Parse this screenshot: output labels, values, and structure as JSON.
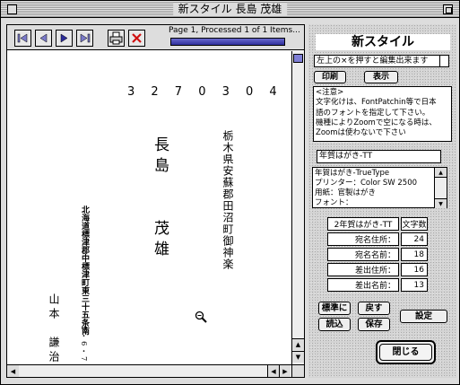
{
  "window": {
    "title": "新スタイル 長島 茂雄"
  },
  "toolbar": {
    "page_status": "Page 1, Processed 1 of 1 Items...",
    "progress": 1.0,
    "buttons": [
      {
        "name": "first-page-button",
        "icon": "first-page-icon"
      },
      {
        "name": "prev-page-button",
        "icon": "prev-page-icon"
      },
      {
        "name": "next-page-button",
        "icon": "next-page-icon"
      },
      {
        "name": "last-page-button",
        "icon": "last-page-icon"
      },
      {
        "name": "print-button",
        "icon": "printer-icon"
      },
      {
        "name": "cancel-button",
        "icon": "close-x-icon"
      }
    ]
  },
  "preview": {
    "postal_code": "3 2 7 0 3 0 4",
    "recipient_address": "栃木県安蘇郡田沼町御神楽",
    "recipient_name_family": "長島",
    "recipient_name_given": "茂雄",
    "sender_address": "北海道標津郡中標津町東三十五条南",
    "sender_address_num": "5・6・7",
    "sender_name_family": "山本",
    "sender_name_given": "謙治"
  },
  "panel": {
    "app_title": "新スタイル",
    "hint": "左上の×を押すと編集出来ます",
    "print_label": "印刷",
    "display_label": "表示",
    "notice_lines": [
      "<注意>",
      "文字化けは、FontPatchin等で日本",
      "語のフォントを指定して下さい。",
      "機種によりZoomで空になる時は、",
      "Zoomは使わないで下さい"
    ],
    "template_name": "年賀はがき-TT",
    "info_lines": [
      "年賀はがき-TrueType",
      "プリンター：Color SW 2500",
      "用紙：官製はがき",
      "フォント："
    ],
    "table": {
      "header_name": "2年賀はがき-TT",
      "header_count": "文字数",
      "rows": [
        {
          "label": "宛名住所：",
          "value": "24"
        },
        {
          "label": "宛名名前：",
          "value": "18"
        },
        {
          "label": "差出住所：",
          "value": "16"
        },
        {
          "label": "差出名前：",
          "value": "13"
        }
      ]
    },
    "standard_label": "標準に",
    "back_label": "戻す",
    "load_label": "読込",
    "save_label": "保存",
    "settings_label": "設定",
    "close_label": "閉じる"
  }
}
